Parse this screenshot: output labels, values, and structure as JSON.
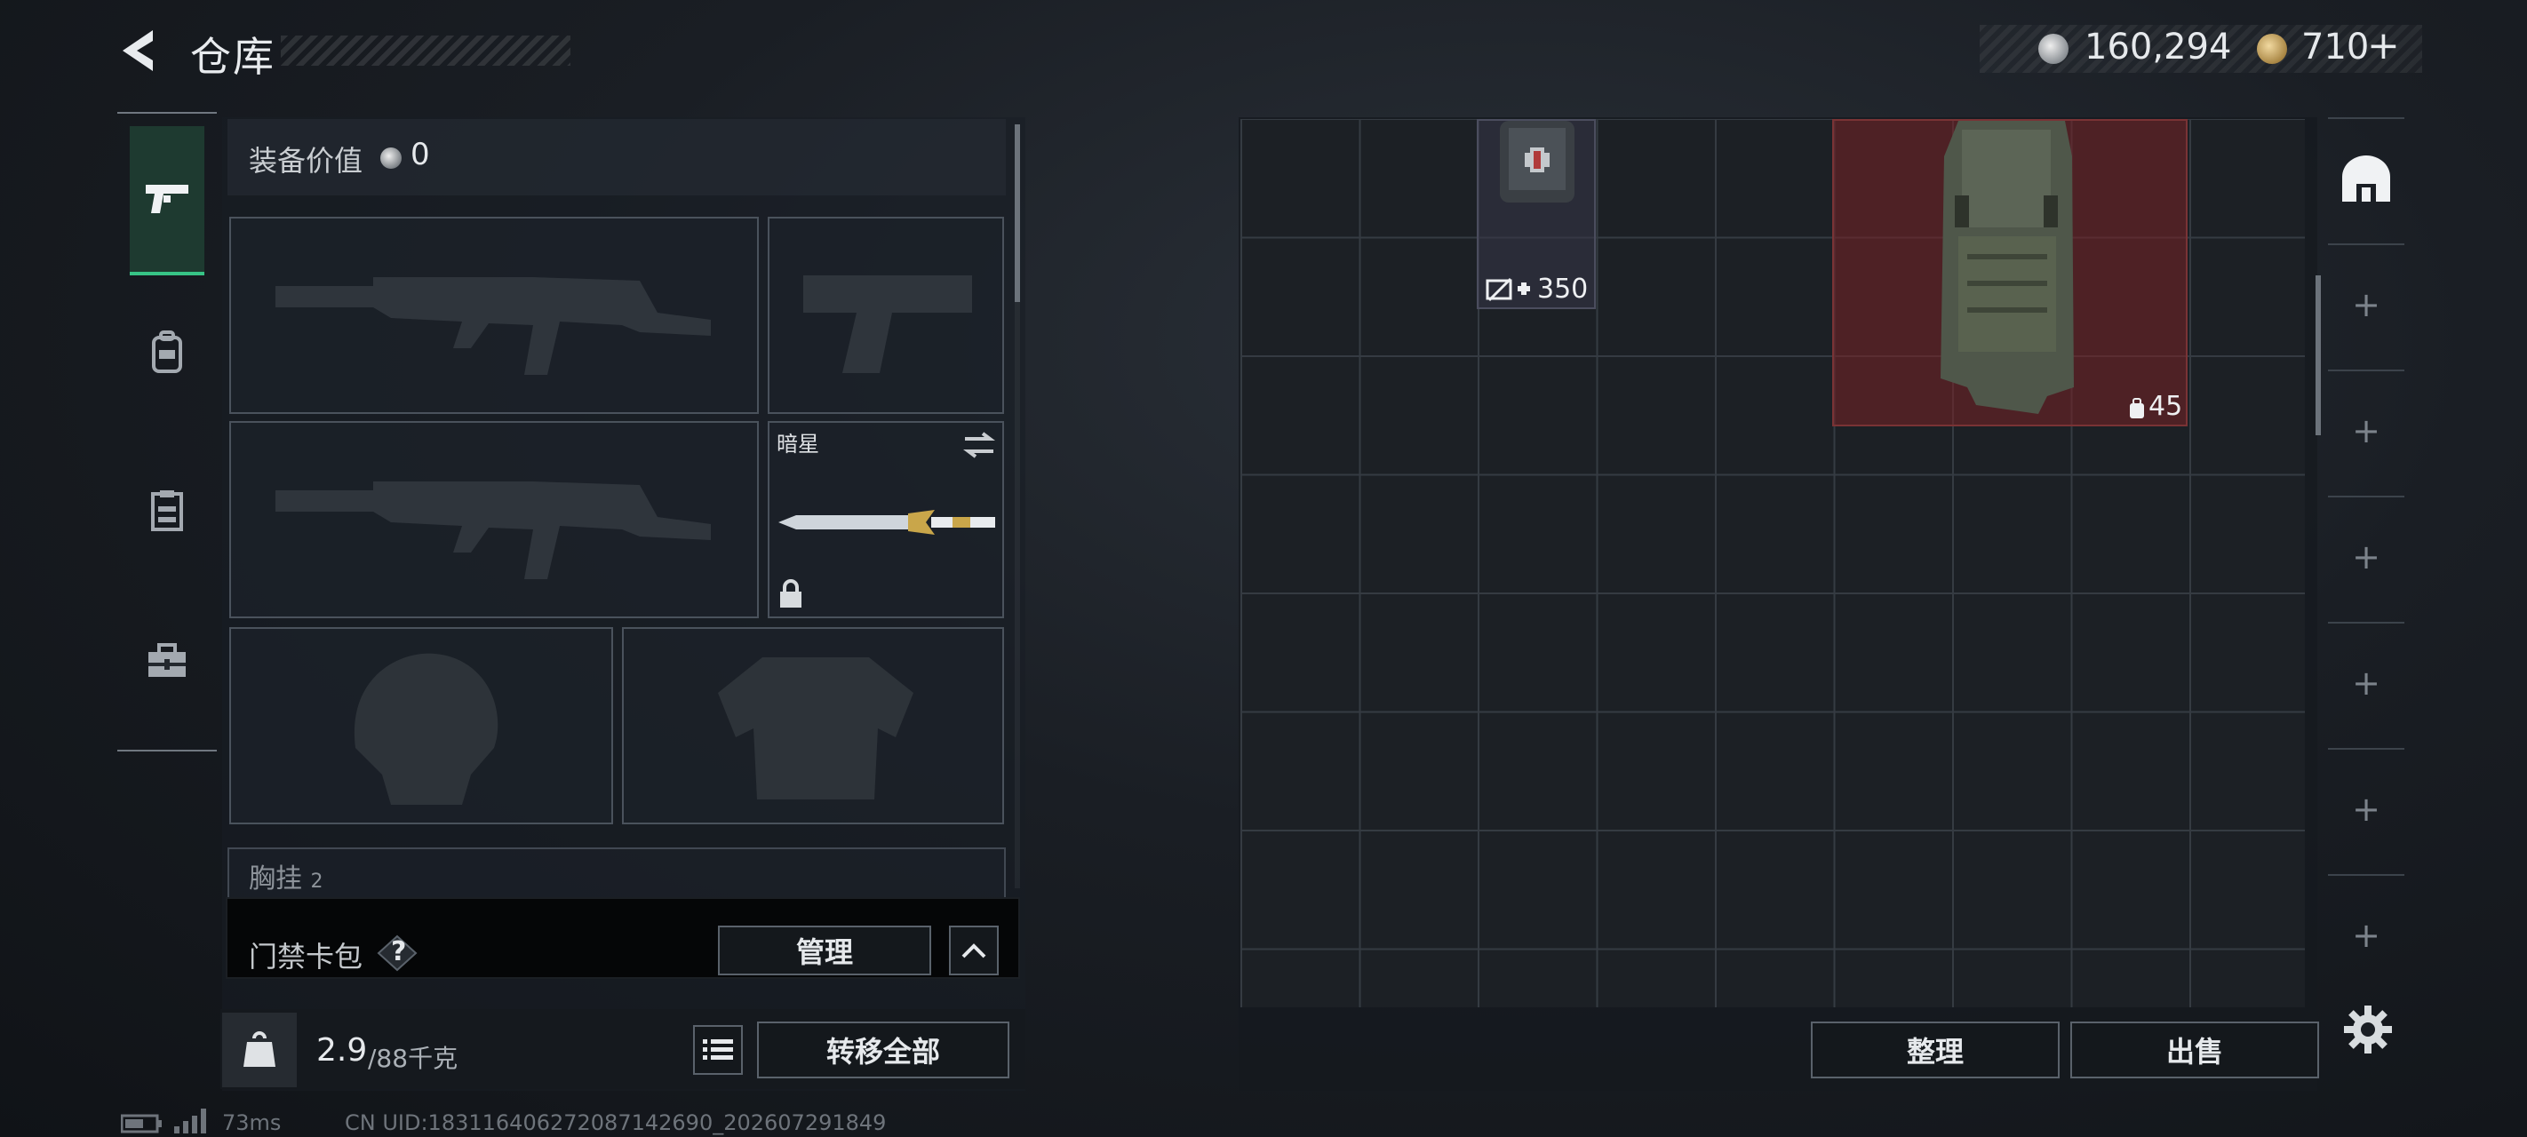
{
  "header": {
    "title": "仓库",
    "currency_silver": "160,294",
    "currency_gold": "710",
    "currency_gold_add": "+"
  },
  "tabs": [
    {
      "name": "weapon",
      "icon": "pistol-icon",
      "active": true
    },
    {
      "name": "backpack",
      "icon": "backpack-icon",
      "active": false
    },
    {
      "name": "chest-rig",
      "icon": "chest-rig-icon",
      "active": false
    },
    {
      "name": "toolbox",
      "icon": "toolbox-icon",
      "active": false
    }
  ],
  "equipment": {
    "value_label": "装备价值",
    "value": "0",
    "melee_name": "暗星",
    "vest_label": "胸挂",
    "vest_count": "2"
  },
  "keycard": {
    "label": "门禁卡包",
    "help": "?",
    "manage_label": "管理"
  },
  "weight": {
    "icon_text": "KG",
    "current": "2.9",
    "max": "/88千克"
  },
  "actions": {
    "transfer_all_label": "转移全部",
    "sort_label": "整理",
    "sell_label": "出售"
  },
  "stash_items": {
    "medkit_count": "350",
    "bag_count": "45"
  },
  "status": {
    "ping": "73ms",
    "uid": "CN UID:183116406272087142690_202607291849"
  },
  "colors": {
    "accent_green": "#37c486",
    "bag_highlight": "#7a2326"
  }
}
